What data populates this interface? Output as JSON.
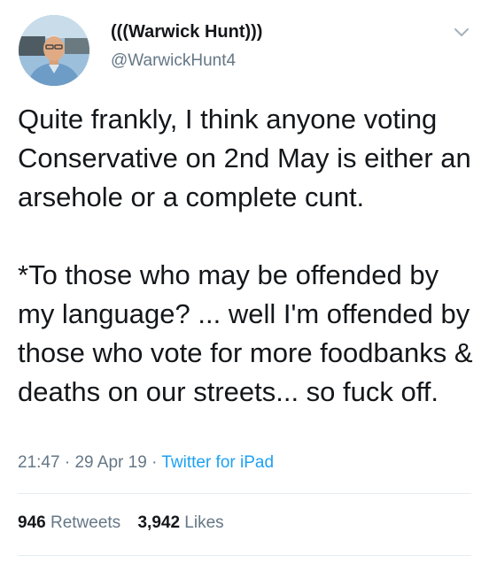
{
  "tweet": {
    "display_name": "(((Warwick Hunt)))",
    "handle": "@WarwickHunt4",
    "paragraphs": [
      "Quite frankly, I think anyone voting Conservative on 2nd May is either an arsehole or a complete cunt.",
      "*To those who may be offended by my language? ... well I'm offended by those who vote for more foodbanks & deaths on our streets... so fuck off."
    ],
    "time": "21:47",
    "date": "29 Apr 19",
    "source": "Twitter for iPad",
    "separator": "·"
  },
  "stats": {
    "retweets_count": "946",
    "retweets_label": "Retweets",
    "likes_count": "3,942",
    "likes_label": "Likes"
  },
  "icons": {
    "menu": "chevron-down-icon",
    "avatar": "profile-photo"
  },
  "colors": {
    "text": "#14171a",
    "secondary": "#657786",
    "link": "#1da1f2",
    "divider": "#e6ecf0"
  }
}
